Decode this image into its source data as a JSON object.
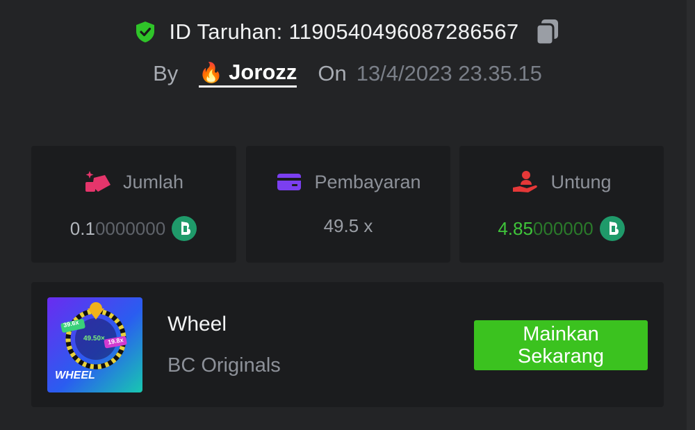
{
  "header": {
    "bet_id_text": "ID Taruhan: 1190540496087286567",
    "by_label": "By",
    "user": "Jorozz",
    "on_label": "On",
    "date": "13/4/2023 23.35.15"
  },
  "stats": {
    "amount": {
      "label": "Jumlah",
      "value_main": "0.1",
      "value_tail": "0000000",
      "icon": "coin-stack-icon"
    },
    "payout": {
      "label": "Pembayaran",
      "value": "49.5 x",
      "icon": "card-icon"
    },
    "profit": {
      "label": "Untung",
      "value_main": "4.85",
      "value_tail": "000000",
      "icon": "hand-user-icon"
    }
  },
  "game": {
    "title": "Wheel",
    "provider": "BC Originals",
    "thumb_text": "WHEEL",
    "thumb_multiplier_center": "49.50×",
    "thumb_multiplier_left": "39.6x",
    "thumb_multiplier_right": "19.8x",
    "play_label": "Mainkan Sekarang"
  },
  "colors": {
    "background": "#232426",
    "card": "#1b1c1e",
    "accent_green": "#3bc21f",
    "profit_green": "#3fc43a"
  }
}
